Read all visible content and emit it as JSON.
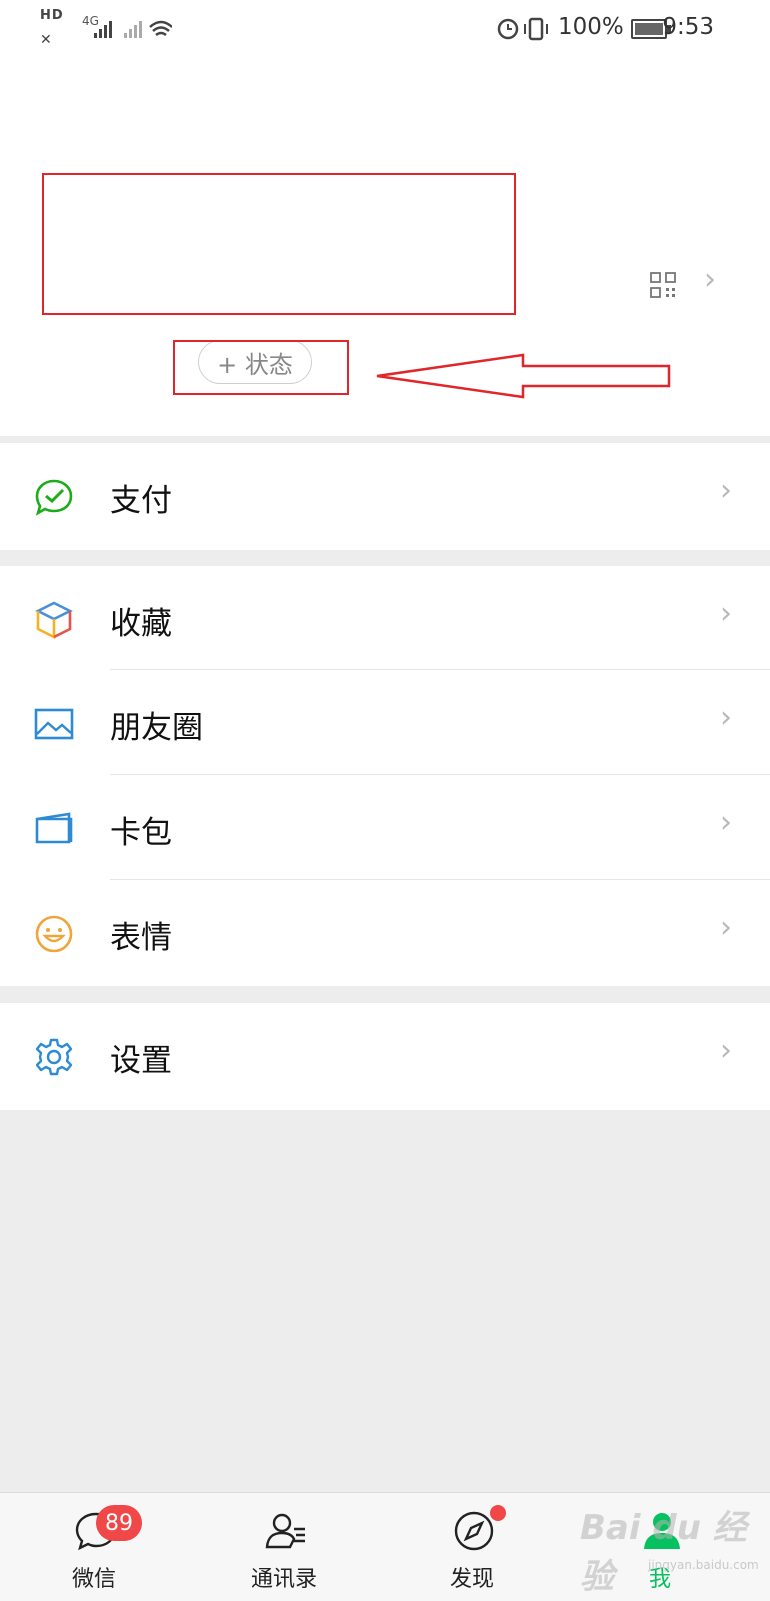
{
  "status_bar": {
    "hd": "HD",
    "network": "4G",
    "battery": "100%",
    "time": "9:53"
  },
  "profile": {
    "status_button": "+ 状态"
  },
  "menu": {
    "pay": "支付",
    "favorites": "收藏",
    "moments": "朋友圈",
    "cards": "卡包",
    "stickers": "表情",
    "settings": "设置"
  },
  "tabbar": {
    "chats": "微信",
    "chats_badge": "89",
    "contacts": "通讯录",
    "discover": "发现",
    "me": "我"
  },
  "colors": {
    "accent": "#07c160",
    "badge": "#f04848",
    "annotation": "#e0262a"
  },
  "watermark": {
    "text": "Bai du 经验",
    "sub": "jingyan.baidu.com"
  }
}
